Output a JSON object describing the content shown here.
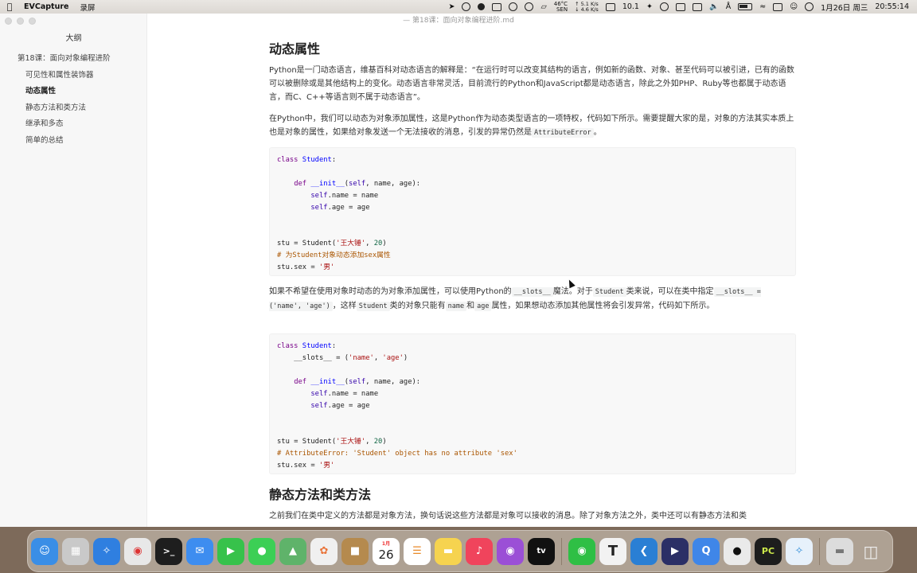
{
  "menubar": {
    "app_name": "EVCapture",
    "menu": "录屏",
    "temp_top": "46°C",
    "temp_bottom": "SEN",
    "net_up": "↑ 5.1 K/s",
    "net_down": "↓ 4.6 K/s",
    "app_item": "10.1",
    "date": "1月26日 周三",
    "time": "20:55:14"
  },
  "window": {
    "title": "— 第18课：面向对象编程进阶.md"
  },
  "sidebar": {
    "title": "大纲",
    "items": [
      {
        "label": "第18课：面向对象编程进阶"
      },
      {
        "label": "可见性和属性装饰器"
      },
      {
        "label": "动态属性"
      },
      {
        "label": "静态方法和类方法"
      },
      {
        "label": "继承和多态"
      },
      {
        "label": "简单的总结"
      }
    ]
  },
  "doc": {
    "h_dynamic": "动态属性",
    "p1": "Python是一门动态语言，维基百科对动态语言的解释是：“在运行时可以改变其结构的语言，例如新的函数、对象、甚至代码可以被引进，已有的函数可以被删除或是其他结构上的变化。动态语言非常灵活，目前流行的Python和JavaScript都是动态语言，除此之外如PHP、Ruby等也都属于动态语言，而C、C++等语言则不属于动态语言”。",
    "p2_a": "在Python中，我们可以动态为对象添加属性，这是Python作为动态类型语言的一项特权，代码如下所示。需要提醒大家的是，对象的方法其实本质上也是对象的属性，如果给对象发送一个无法接收的消息，引发的异常仍然是",
    "p2_code": "AttributeError",
    "p2_b": "。",
    "code1": {
      "l1_kw": "class",
      "l1_name": "Student",
      "l1_end": ":",
      "l3_kw": "def",
      "l3_name": "__init__",
      "l3_open": "(",
      "l3_self": "self",
      "l3_rest": ", name, age):",
      "l4_self": "self",
      "l4_rest": ".name = name",
      "l5_self": "self",
      "l5_rest": ".age = age",
      "l8_a": "stu = Student(",
      "l8_str": "'王大锤'",
      "l8_sep": ", ",
      "l8_num": "20",
      "l8_end": ")",
      "l9_cmt": "# 为Student对象动态添加sex属性",
      "l10_a": "stu.sex = ",
      "l10_str": "'男'"
    },
    "p3_a": "如果不希望在使用对象时动态的为对象添加属性，可以使用Python的",
    "p3_c1": "__slots__",
    "p3_b": "魔法。对于",
    "p3_c2": "Student",
    "p3_c": "类来说，可以在类中指定",
    "p3_c3": "__slots__ = ('name', 'age')",
    "p3_d": "，这样",
    "p3_c4": "Student",
    "p3_e": "类的对象只能有",
    "p3_c5": "name",
    "p3_f": "和",
    "p3_c6": "age",
    "p3_g": "属性，如果想动态添加其他属性将会引发异常，代码如下所示。",
    "code2": {
      "l1_kw": "class",
      "l1_name": "Student",
      "l1_end": ":",
      "l2_a": "    __slots__ = (",
      "l2_s1": "'name'",
      "l2_sep": ", ",
      "l2_s2": "'age'",
      "l2_end": ")",
      "l4_kw": "def",
      "l4_name": "__init__",
      "l4_open": "(",
      "l4_self": "self",
      "l4_rest": ", name, age):",
      "l5_self": "self",
      "l5_rest": ".name = name",
      "l6_self": "self",
      "l6_rest": ".age = age",
      "l9_a": "stu = Student(",
      "l9_str": "'王大锤'",
      "l9_sep": ", ",
      "l9_num": "20",
      "l9_end": ")",
      "l10_cmt": "# AttributeError: 'Student' object has no attribute 'sex'",
      "l11_a": "stu.sex = ",
      "l11_str": "'男'"
    },
    "h_static": "静态方法和类方法",
    "p4": "之前我们在类中定义的方法都是对象方法，换句话说这些方法都是对象可以接收的消息。除了对象方法之外，类中还可以有静态方法和类"
  },
  "dock": {
    "apps": [
      {
        "icon": "finder-icon",
        "color": "#3a8ee6"
      },
      {
        "icon": "launchpad-icon",
        "color": "#c9c9c9"
      },
      {
        "icon": "safari-icon",
        "color": "#2f7fe0"
      },
      {
        "icon": "chrome-icon",
        "color": "#e8e8e8"
      },
      {
        "icon": "terminal-icon",
        "color": "#1e1e1e"
      },
      {
        "icon": "mail-icon",
        "color": "#3d8df0"
      },
      {
        "icon": "facetime-icon",
        "color": "#37c24b"
      },
      {
        "icon": "messages-icon",
        "color": "#3ccf55"
      },
      {
        "icon": "maps-icon",
        "color": "#5fb36a"
      },
      {
        "icon": "photos-icon",
        "color": "#f0f0f0"
      },
      {
        "icon": "contacts-icon",
        "color": "#b58a4e"
      },
      {
        "icon": "calendar-icon",
        "color": "#ffffff"
      },
      {
        "icon": "reminders-icon",
        "color": "#ffffff"
      },
      {
        "icon": "notes-icon",
        "color": "#f6d34f"
      },
      {
        "icon": "music-icon",
        "color": "#f0445c"
      },
      {
        "icon": "podcasts-icon",
        "color": "#9b4fd6"
      },
      {
        "icon": "appletv-icon",
        "color": "#111111"
      },
      {
        "icon": "wechat-icon",
        "color": "#2fbf45"
      },
      {
        "icon": "typora-icon",
        "color": "#f2f2f2"
      },
      {
        "icon": "vscode-icon",
        "color": "#2a7fd4"
      },
      {
        "icon": "screen-recorder-icon",
        "color": "#2b2f66"
      },
      {
        "icon": "quickq-icon",
        "color": "#3f86e8"
      },
      {
        "icon": "qq-icon",
        "color": "#eaeaea"
      },
      {
        "icon": "pycharm-icon",
        "color": "#1d1d1d"
      },
      {
        "icon": "network-icon",
        "color": "#e7f1fb"
      }
    ],
    "calendar_month": "1月",
    "calendar_day": "26",
    "typora_letter": "T",
    "pycharm_letter": "PC"
  }
}
